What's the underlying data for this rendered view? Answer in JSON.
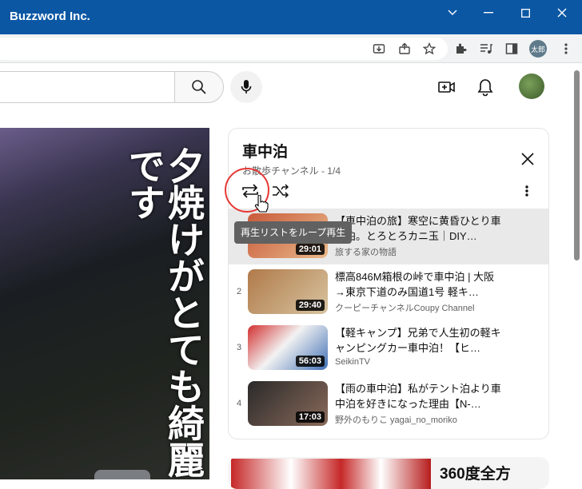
{
  "window": {
    "title": "Buzzword Inc."
  },
  "browser": {
    "profile_label": "太郎"
  },
  "player": {
    "overlay_text": "夕焼けがとても綺麗です"
  },
  "playlist": {
    "title": "車中泊",
    "subtitle": "お散歩チャンネル - 1/4",
    "tooltip": "再生リストをループ再生",
    "items": [
      {
        "index": "",
        "title": "【車中泊の旅】寒空に黄昏ひとり車中泊。とろとろカニ玉｜DIY…",
        "channel": "旅する家の物語",
        "duration": "29:01",
        "progress": 0.0,
        "colors": [
          "#c85a3a",
          "#e9b98a"
        ]
      },
      {
        "index": "2",
        "title": "標高846M箱根の峠で車中泊 | 大阪→東京下道のみ国道1号 軽キ…",
        "channel": "クーピーチャンネルCoupy Channel",
        "duration": "29:40",
        "progress": 0.0,
        "colors": [
          "#b07a4a",
          "#d8c4a0"
        ]
      },
      {
        "index": "3",
        "title": "【軽キャンプ】兄弟で人生初の軽キャンピングカー車中泊！【ヒ…",
        "channel": "SeikinTV",
        "duration": "56:03",
        "progress": 0.0,
        "colors": [
          "#d32f2f",
          "#3f6fb5"
        ]
      },
      {
        "index": "4",
        "title": "【雨の車中泊】私がテント泊より車中泊を好きになった理由【N-…",
        "channel": "野外のもりこ yagai_no_moriko",
        "duration": "17:03",
        "progress": 0.0,
        "colors": [
          "#2a2a2a",
          "#8a6a5a"
        ]
      }
    ]
  },
  "next_card": {
    "text": "360度全方"
  },
  "colors": {
    "titlebar": "#0b57a4",
    "accent_red": "#e53935"
  }
}
